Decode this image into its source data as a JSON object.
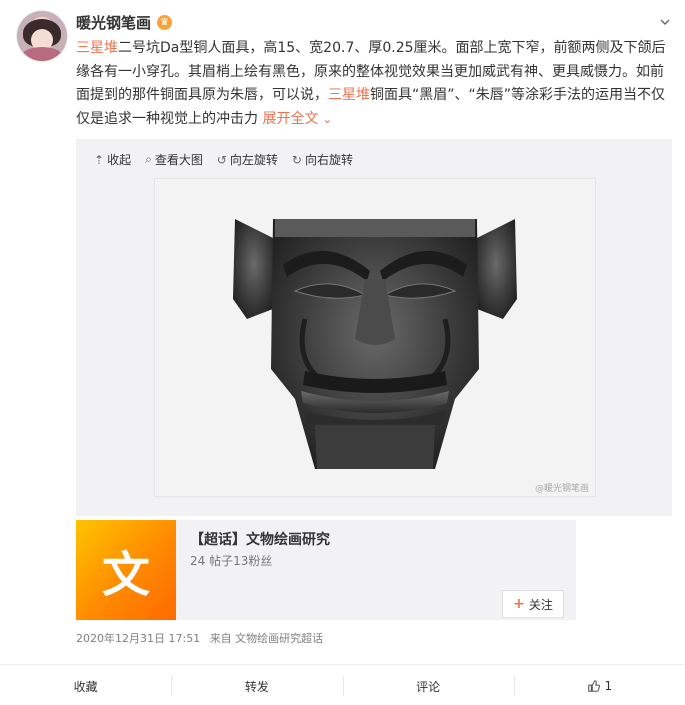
{
  "author": {
    "name": "暖光钢笔画",
    "badge_icon": "crown-icon"
  },
  "post": {
    "segments": [
      {
        "text": "三星堆",
        "highlight": true
      },
      {
        "text": "二号坑Da型铜人面具，高15、宽20.7、厚0.25厘米。面部上宽下窄，前额两侧及下颌后缘各有一小穿孔。其眉梢上绘有黑色，原来的整体视觉效果当更加威武有神、更具威慑力。如前面提到的那件铜面具原为朱唇，可以说，",
        "highlight": false
      },
      {
        "text": "三星堆",
        "highlight": true
      },
      {
        "text": "铜面具“黑眉”、“朱唇”等涂彩手法的运用当不仅仅是追求一种视觉上的冲击力 ",
        "highlight": false
      },
      {
        "text": "展开全文",
        "highlight": "expand"
      }
    ]
  },
  "media_tools": {
    "collapse": "收起",
    "view_large": "查看大图",
    "rotate_left": "向左旋转",
    "rotate_right": "向右旋转"
  },
  "photo": {
    "watermark": "@暖光钢笔画"
  },
  "topic": {
    "thumb_char": "文",
    "title": "【超话】文物绘画研究",
    "stats": "24 帖子13粉丝",
    "follow_label": "关注"
  },
  "meta": {
    "timestamp": "2020年12月31日 17:51",
    "source": "来自 文物绘画研究超话"
  },
  "actions": {
    "favorite": "收藏",
    "repost": "转发",
    "comment": "评论",
    "like_count": "1"
  },
  "colors": {
    "accent": "#eb7350",
    "topic_gradient_start": "#ffc400",
    "topic_gradient_end": "#ff6a00"
  }
}
